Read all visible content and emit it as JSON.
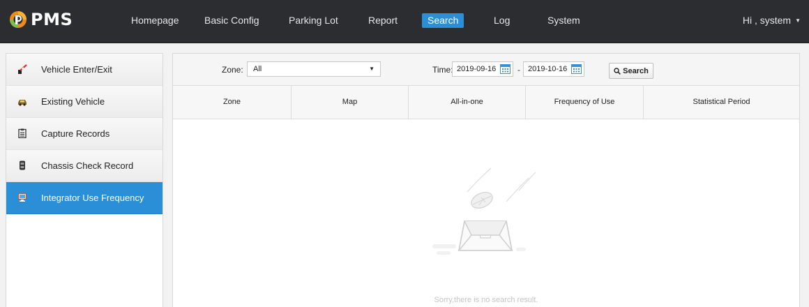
{
  "app": {
    "name": "PMS"
  },
  "nav": {
    "items": [
      {
        "label": "Homepage",
        "active": false
      },
      {
        "label": "Basic Config",
        "active": false
      },
      {
        "label": "Parking Lot",
        "active": false
      },
      {
        "label": "Report",
        "active": false
      },
      {
        "label": "Search",
        "active": true
      },
      {
        "label": "Log",
        "active": false
      },
      {
        "label": "System",
        "active": false
      }
    ],
    "user": "Hi , system"
  },
  "sidebar": {
    "items": [
      {
        "label": "Vehicle Enter/Exit",
        "icon": "barrier-gate-icon"
      },
      {
        "label": "Existing Vehicle",
        "icon": "car-icon"
      },
      {
        "label": "Capture Records",
        "icon": "clipboard-icon"
      },
      {
        "label": "Chassis Check Record",
        "icon": "chassis-icon"
      },
      {
        "label": "Integrator Use Frequency",
        "icon": "monitor-icon",
        "active": true
      }
    ]
  },
  "filters": {
    "zone_label": "Zone:",
    "zone_value": "All",
    "time_label": "Time:",
    "date_start": "2019-09-16",
    "date_end": "2019-10-16",
    "separator": "-",
    "search_label": "Search"
  },
  "table": {
    "columns": [
      "Zone",
      "Map",
      "All-in-one",
      "Frequency of Use",
      "Statistical Period"
    ],
    "rows": []
  },
  "empty": {
    "message": "Sorry,there is no search result."
  },
  "colors": {
    "topbar": "#2c2d30",
    "accent": "#2b8fd8",
    "logo_orange": "#f08a1c",
    "logo_green": "#7cc04a"
  }
}
